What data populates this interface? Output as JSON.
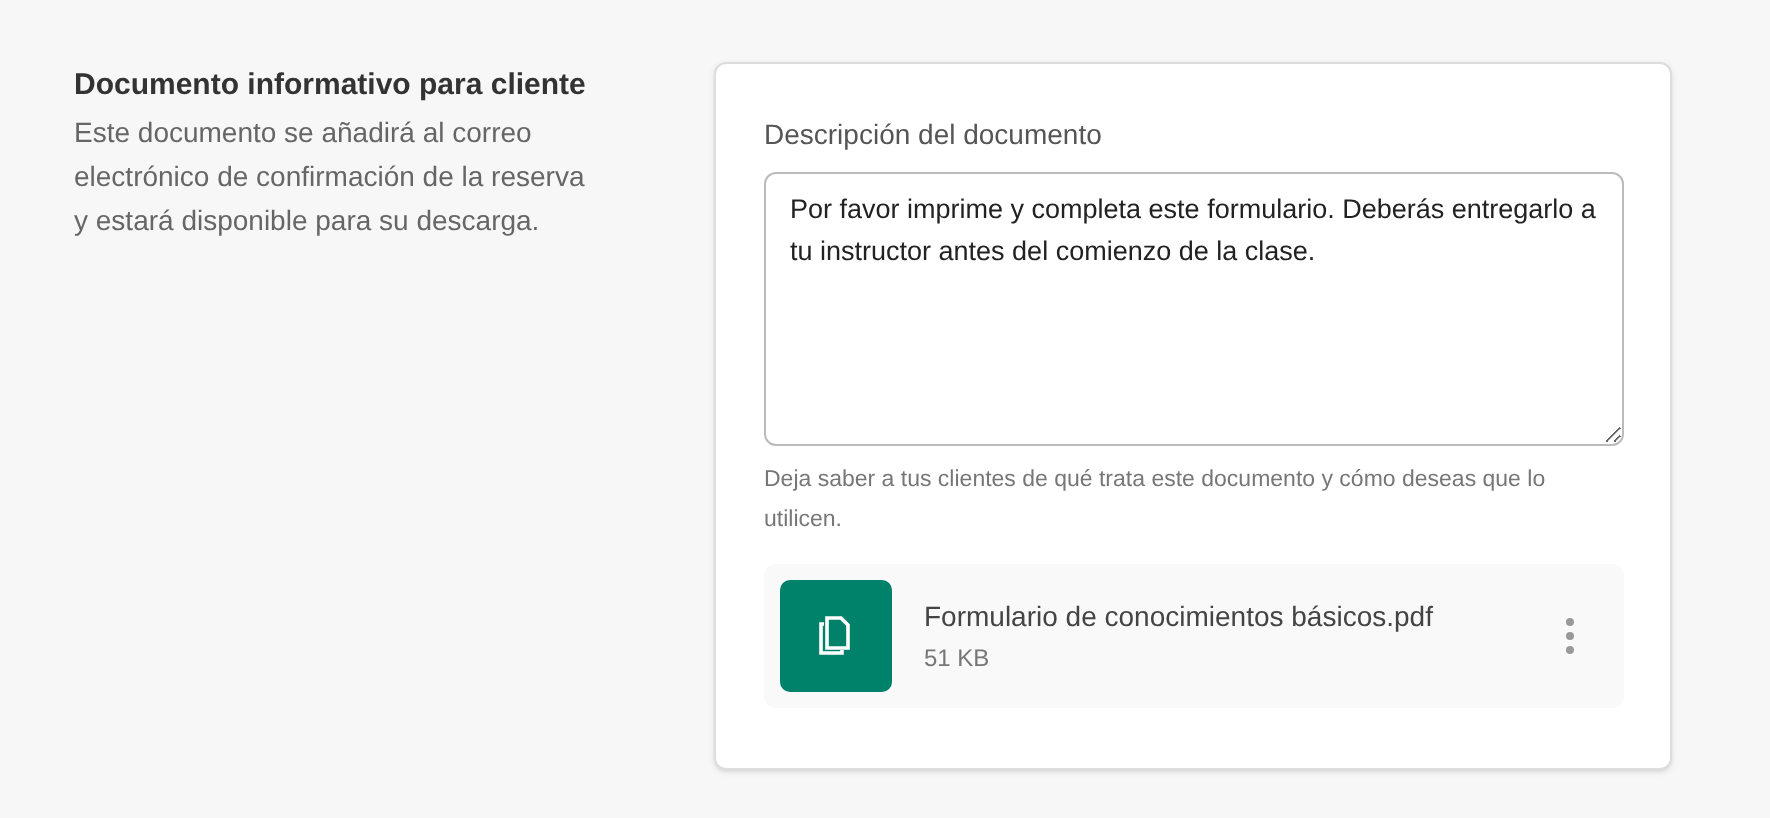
{
  "section": {
    "title": "Documento informativo para cliente",
    "description": "Este documento se añadirá al correo electrónico de confirmación de la reserva y estará disponible para su descarga."
  },
  "description_field": {
    "label": "Descripción del documento",
    "value": "Por favor imprime y completa este formulario. Deberás entregarlo a tu instructor antes del comienzo de la clase.",
    "hint": "Deja saber a tus clientes de qué trata este documento y cómo deseas que lo utilicen."
  },
  "attachment": {
    "name": "Formulario de conocimientos básicos.pdf",
    "size": "51 KB"
  }
}
